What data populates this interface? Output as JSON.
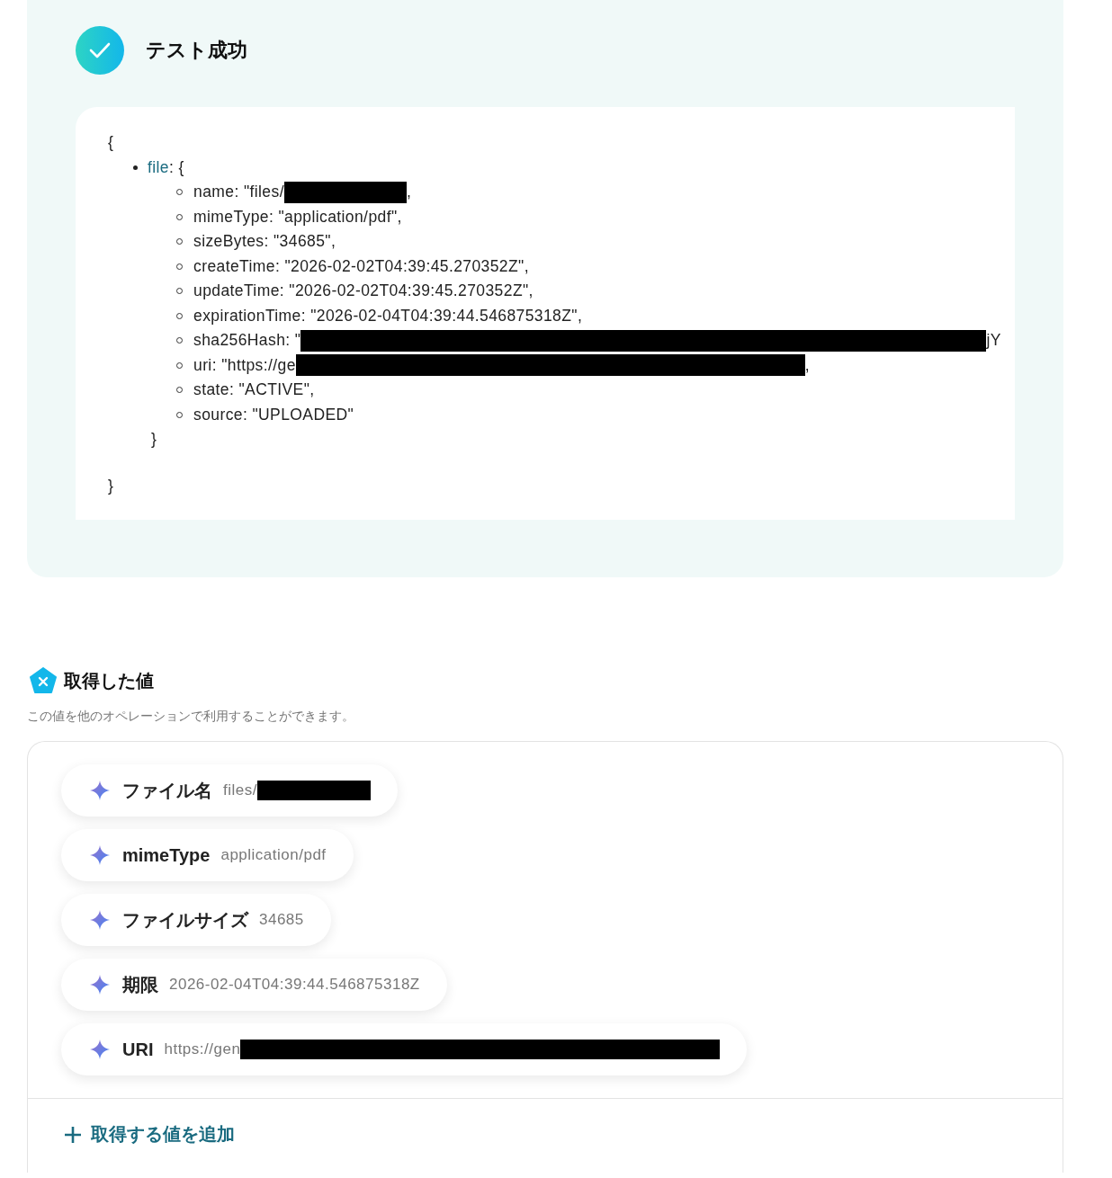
{
  "result": {
    "success": true,
    "title": "テスト成功",
    "code": {
      "open": "{",
      "key": "file",
      "key_open": ": {",
      "close_inner": "}",
      "close": "}",
      "fields": [
        {
          "text": "name: \"files/",
          "redacted": true,
          "suffix": ","
        },
        {
          "text": "mimeType: \"application/pdf\",",
          "redacted": false
        },
        {
          "text": "sizeBytes: \"34685\",",
          "redacted": false
        },
        {
          "text": "createTime: \"2026-02-02T04:39:45.270352Z\",",
          "redacted": false
        },
        {
          "text": "updateTime: \"2026-02-02T04:39:45.270352Z\",",
          "redacted": false
        },
        {
          "text": "expirationTime: \"2026-02-04T04:39:44.546875318Z\",",
          "redacted": false
        },
        {
          "text": "sha256Hash: \"",
          "redacted": true,
          "suffix": "jY"
        },
        {
          "text": "uri: \"https://ge",
          "redacted": true,
          "suffix": ","
        },
        {
          "text": "state: \"ACTIVE\",",
          "redacted": false
        },
        {
          "text": "source: \"UPLOADED\"",
          "redacted": false
        }
      ]
    }
  },
  "values": {
    "title": "取得した値",
    "description": "この値を他のオペレーションで利用することができます。",
    "items": [
      {
        "label": "ファイル名",
        "value": "files/",
        "redacted": true
      },
      {
        "label": "mimeType",
        "value": "application/pdf",
        "redacted": false
      },
      {
        "label": "ファイルサイズ",
        "value": "34685",
        "redacted": false
      },
      {
        "label": "期限",
        "value": "2026-02-04T04:39:44.546875318Z",
        "redacted": false
      },
      {
        "label": "URI",
        "value": "https://gen",
        "redacted": true
      }
    ],
    "add_button": "取得する値を追加"
  }
}
